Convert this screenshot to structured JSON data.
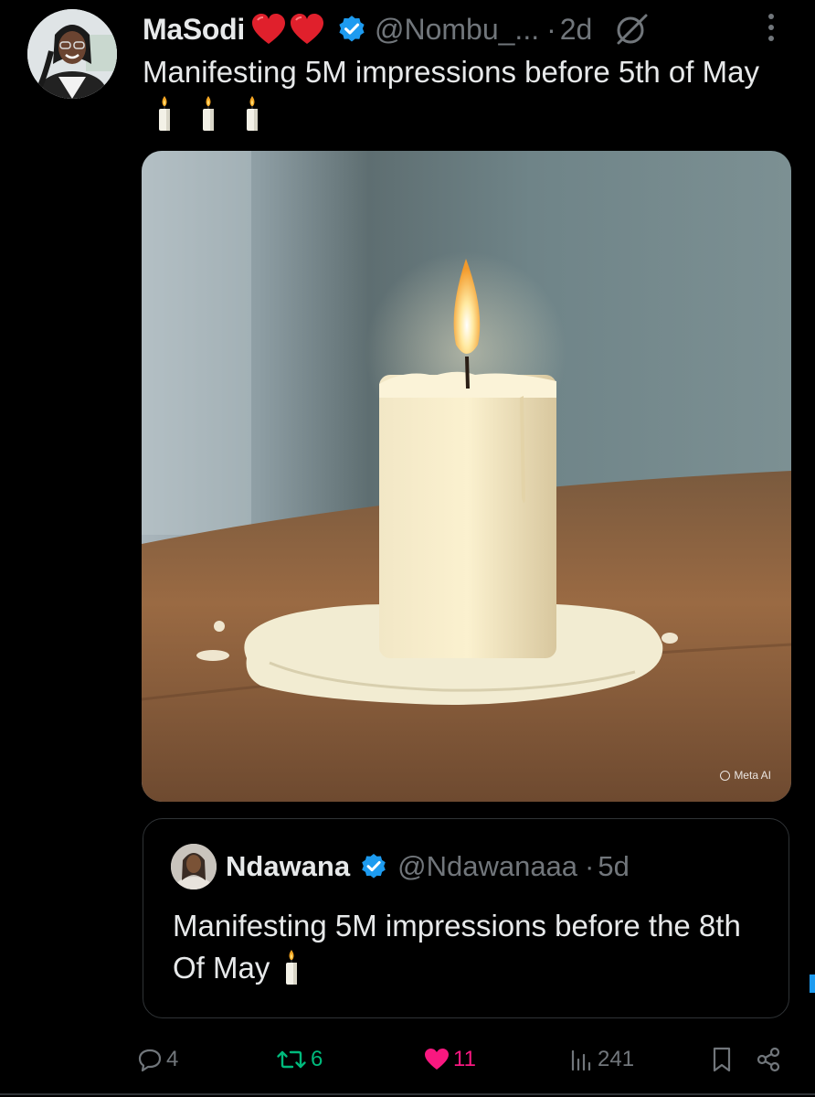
{
  "tweet": {
    "author": {
      "display_name": "MaSodi",
      "emoji_hearts": [
        "red-heart-icon",
        "red-heart-icon"
      ],
      "verified_icon": "verified-badge-icon",
      "handle": "@Nombu_...",
      "separator": "·",
      "time": "2d"
    },
    "header_icons": [
      "grok-icon",
      "more-options-icon"
    ],
    "text": "Manifesting 5M impressions before 5th of May",
    "text_emojis": [
      "candle-icon",
      "candle-icon",
      "candle-icon"
    ],
    "media": {
      "alt": "candle",
      "watermark": "Meta AI"
    },
    "quoted": {
      "display_name": "Ndawana",
      "verified_icon": "verified-badge-icon",
      "handle": "@Ndawanaaa",
      "separator": "·",
      "time": "5d",
      "text": "Manifesting 5M impressions before the 8th Of May",
      "text_emojis": [
        "candle-icon"
      ]
    },
    "actions": {
      "reply_count": "4",
      "retweet_count": "6",
      "like_count": "11",
      "view_count": "241"
    }
  },
  "colors": {
    "background": "#000000",
    "primary_text": "#e7e9ea",
    "secondary_text": "#71767b",
    "verified": "#1d9bf0",
    "retweet": "#00ba7c",
    "like": "#f91880",
    "border": "#2f3336"
  }
}
